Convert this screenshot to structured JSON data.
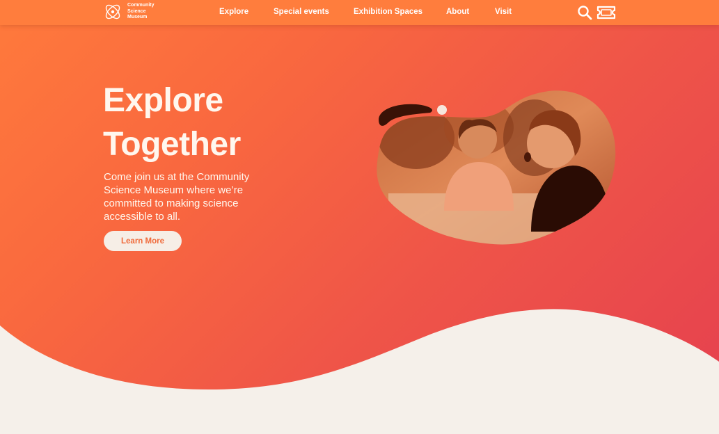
{
  "brand": {
    "line1": "Community",
    "line2": "Science",
    "line3": "Museum"
  },
  "nav": {
    "items": [
      {
        "label": "Explore"
      },
      {
        "label": "Special events"
      },
      {
        "label": "Exhibition Spaces"
      },
      {
        "label": "About"
      },
      {
        "label": "Visit"
      }
    ],
    "icons": [
      "search-icon",
      "ticket-icon"
    ]
  },
  "hero": {
    "title_line1": "Explore",
    "title_line2": "Together",
    "description": "Come join us at the Community Science Museum where we’re committed to making science accessible to all.",
    "cta_label": "Learn More",
    "image": "children-playing-photo"
  },
  "colors": {
    "nav_bg": "#ff7d3d",
    "gradient_start": "#ff7a3c",
    "gradient_end": "#e5404f",
    "cream": "#f5f0ea",
    "button_text": "#f06a3a"
  }
}
